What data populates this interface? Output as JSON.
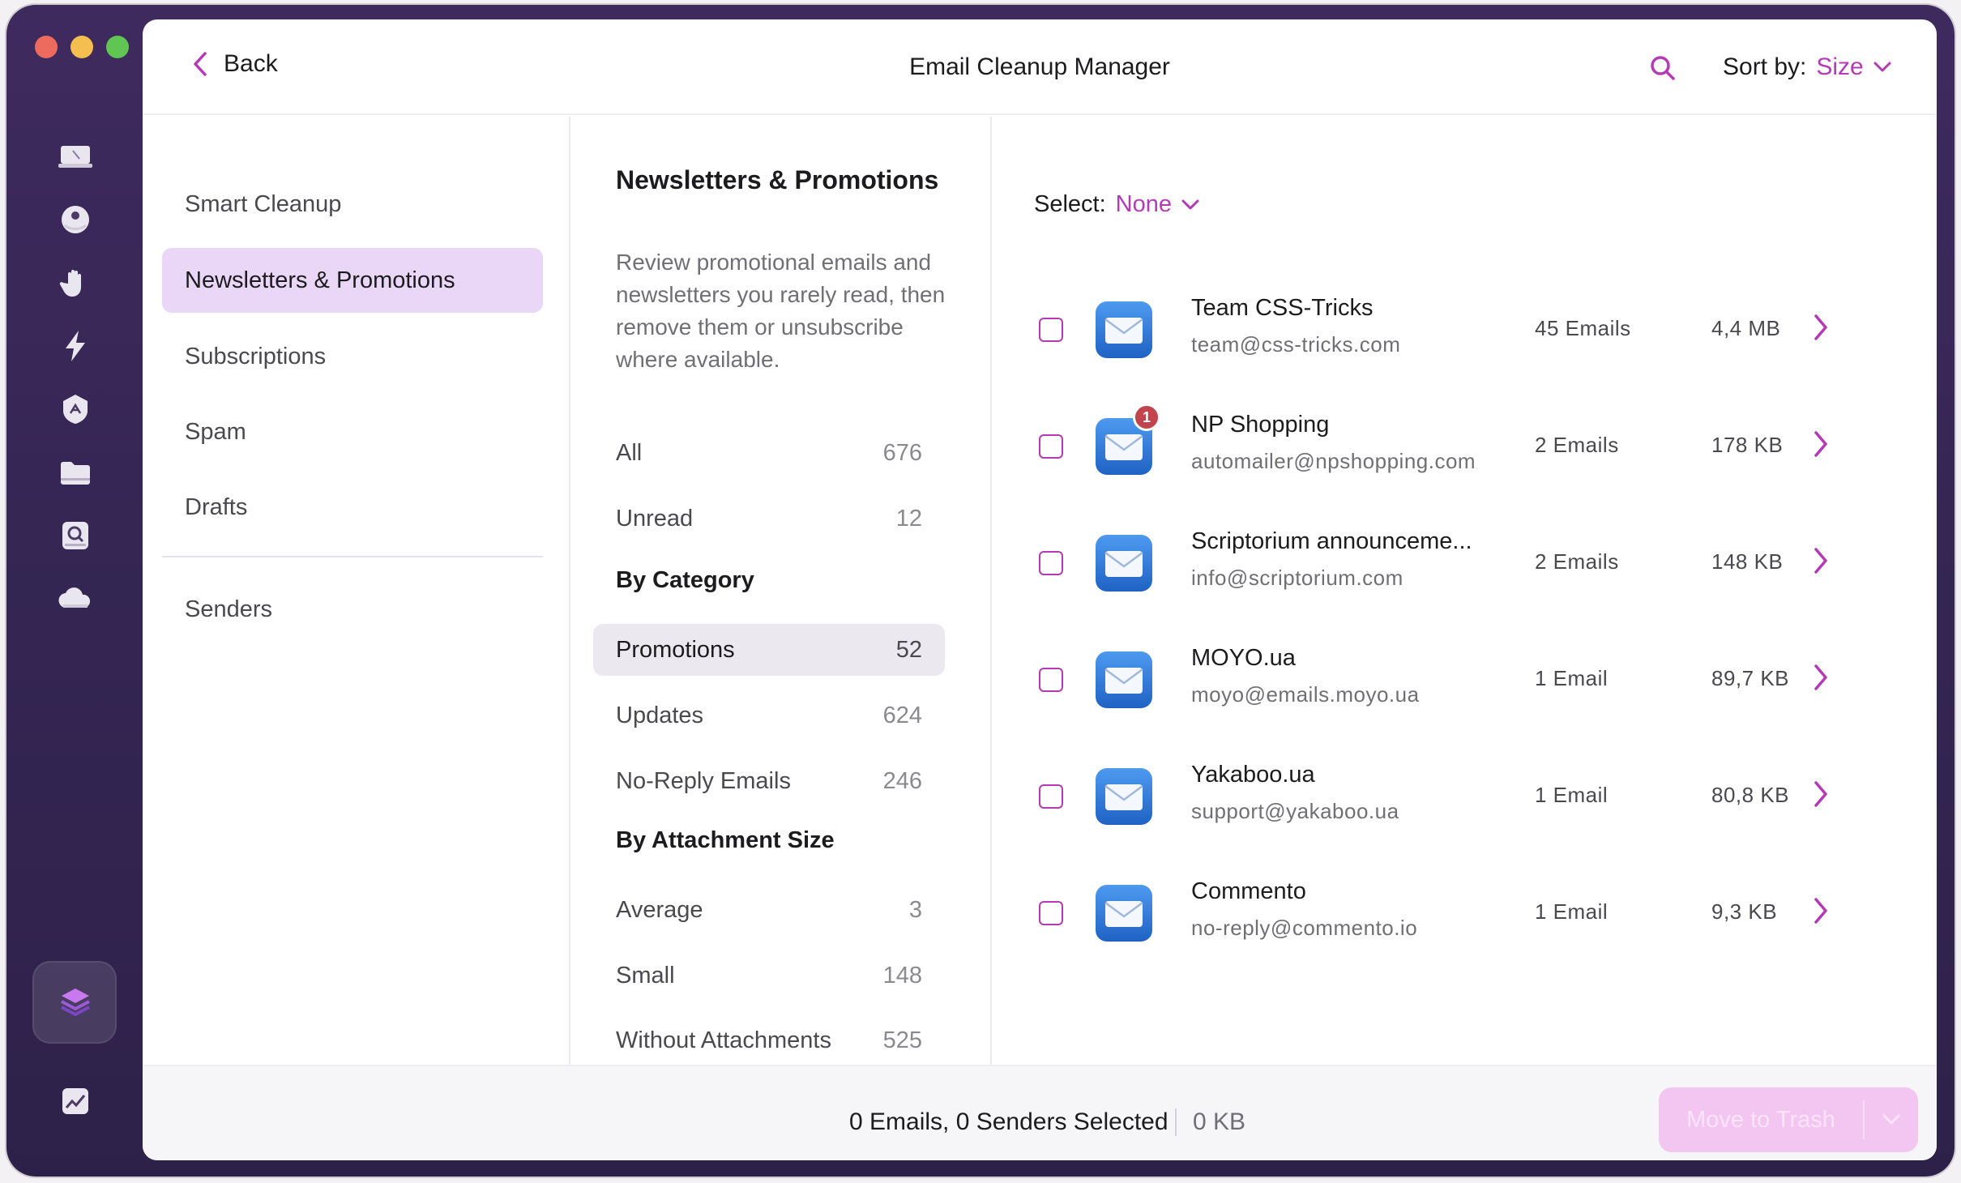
{
  "window": {
    "traffic_lights": [
      "close",
      "minimize",
      "zoom"
    ]
  },
  "rail": {
    "icons": [
      "computer-icon",
      "disk-icon",
      "hand-icon",
      "bolt-icon",
      "shield-icon",
      "folder-icon",
      "search-disk-icon",
      "cloud-icon",
      "layers-icon",
      "chart-icon"
    ],
    "active": "layers-icon"
  },
  "header": {
    "back_label": "Back",
    "title": "Email Cleanup Manager",
    "sort_label": "Sort by:",
    "sort_value": "Size"
  },
  "sidebar": {
    "items": [
      {
        "label": "Smart Cleanup",
        "active": false
      },
      {
        "label": "Newsletters & Promotions",
        "active": true
      },
      {
        "label": "Subscriptions",
        "active": false
      },
      {
        "label": "Spam",
        "active": false
      },
      {
        "label": "Drafts",
        "active": false
      }
    ],
    "senders_label": "Senders"
  },
  "middle": {
    "title": "Newsletters & Promotions",
    "description": "Review promotional emails and newsletters you rarely read, then remove them or unsubscribe where available.",
    "all": {
      "label": "All",
      "count": "676"
    },
    "unread": {
      "label": "Unread",
      "count": "12"
    },
    "by_category": "By Category",
    "categories": [
      {
        "label": "Promotions",
        "count": "52",
        "active": true
      },
      {
        "label": "Updates",
        "count": "624"
      },
      {
        "label": "No-Reply Emails",
        "count": "246"
      }
    ],
    "by_attachment": "By Attachment Size",
    "attachments": [
      {
        "label": "Average",
        "count": "3"
      },
      {
        "label": "Small",
        "count": "148"
      },
      {
        "label": "Without Attachments",
        "count": "525"
      }
    ]
  },
  "list": {
    "select_label": "Select:",
    "select_value": "None",
    "senders": [
      {
        "name": "Team CSS-Tricks",
        "email": "team@css-tricks.com",
        "count": "45 Emails",
        "size": "4,4 MB",
        "badge": ""
      },
      {
        "name": "NP Shopping",
        "email": "automailer@npshopping.com",
        "count": "2 Emails",
        "size": "178 KB",
        "badge": "1"
      },
      {
        "name": "Scriptorium announceme...",
        "email": "info@scriptorium.com",
        "count": "2 Emails",
        "size": "148 KB",
        "badge": ""
      },
      {
        "name": "MOYO.ua",
        "email": "moyo@emails.moyo.ua",
        "count": "1 Email",
        "size": "89,7 KB",
        "badge": ""
      },
      {
        "name": "Yakaboo.ua",
        "email": "support@yakaboo.ua",
        "count": "1 Email",
        "size": "80,8 KB",
        "badge": ""
      },
      {
        "name": "Commento",
        "email": "no-reply@commento.io",
        "count": "1 Email",
        "size": "9,3 KB",
        "badge": ""
      }
    ]
  },
  "footer": {
    "status": "0 Emails, 0 Senders Selected",
    "size": "0 KB",
    "trash_label": "Move to Trash"
  },
  "colors": {
    "accent": "#b43bb5",
    "active_nav": "#ead7f7",
    "window_bg": "#3f2a5e"
  }
}
